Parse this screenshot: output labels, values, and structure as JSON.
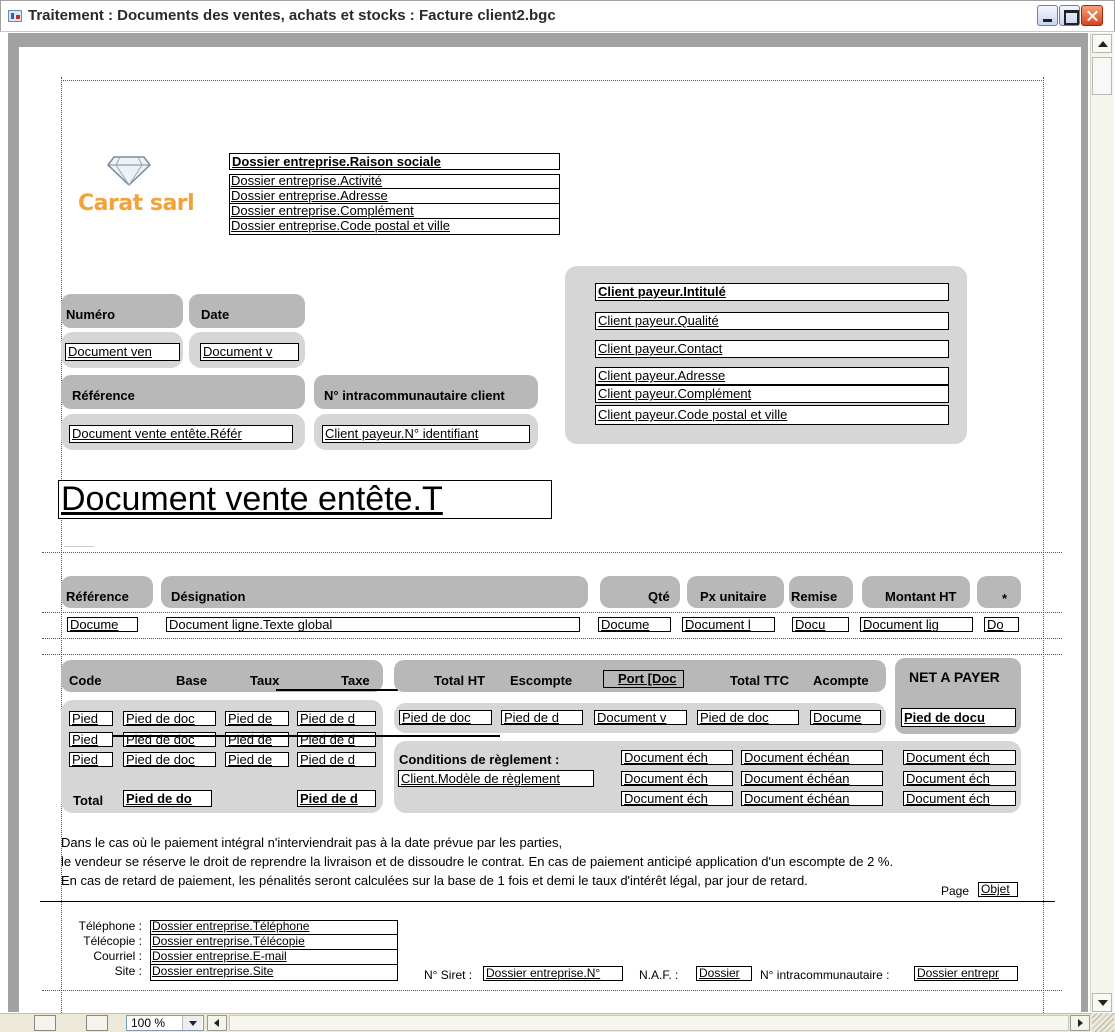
{
  "window": {
    "title": "Traitement : Documents des ventes, achats et stocks : Facture client2.bgc"
  },
  "statusbar": {
    "zoom": "100 %"
  },
  "header": {
    "logo_text": "Carat sarl",
    "company_fields": [
      "Dossier entreprise.Raison sociale",
      "Dossier entreprise.Activité",
      "Dossier entreprise.Adresse",
      "Dossier entreprise.Complément",
      "Dossier entreprise.Code postal et ville"
    ],
    "labels": {
      "numero": "Numéro",
      "date": "Date",
      "reference": "Référence",
      "intracom": "N° intracommunautaire client"
    },
    "values": {
      "numero": "Document ven",
      "date": "Document v",
      "reference": "Document vente entête.Référ",
      "intracom": "Client payeur.N° identifiant"
    },
    "client_fields": [
      "Client payeur.Intitulé",
      "Client payeur.Qualité",
      "Client payeur.Contact",
      "Client payeur.Adresse",
      "Client payeur.Complément",
      "Client payeur.Code postal et ville"
    ],
    "doc_title": "Document vente entête.T"
  },
  "lines": {
    "headers": [
      "Référence",
      "Désignation",
      "Qté",
      "Px unitaire",
      "Remise",
      "Montant HT",
      "*"
    ],
    "cells": [
      "Docume",
      "Document ligne.Texte global",
      "Docume",
      "Document l",
      "Docu",
      "Document lig",
      "Do"
    ]
  },
  "footer": {
    "tax_headers": [
      "Code",
      "Base",
      "Taux",
      "Taxe"
    ],
    "tax_rows": [
      [
        "Pied",
        "Pied de doc",
        "Pied de",
        "Pied de d"
      ],
      [
        "Pied",
        "Pied de doc",
        "Pied de",
        "Pied de d"
      ],
      [
        "Pied",
        "Pied de doc",
        "Pied de",
        "Pied de d"
      ]
    ],
    "total_label": "Total",
    "total_base": "Pied de do",
    "total_taxe": "Pied de d",
    "totals_headers": [
      "Total HT",
      "Escompte",
      "Port [Doc",
      "Total TTC",
      "Acompte"
    ],
    "totals_values": [
      "Pied de doc",
      "Pied de d",
      "Document v",
      "Pied de doc",
      "Docume"
    ],
    "net_label": "NET A PAYER",
    "net_value": "Pied de docu",
    "conditions_label": "Conditions de règlement :",
    "conditions_value": "Client.Modèle de règlement",
    "echeance_rows": [
      [
        "Document éch",
        "Document échéan",
        "Document éch"
      ],
      [
        "Document éch",
        "Document échéan",
        "Document éch"
      ],
      [
        "Document éch",
        "Document échéan",
        "Document éch"
      ]
    ],
    "legal_lines": [
      "Dans le cas où le paiement intégral n'interviendrait pas à la date prévue par les parties,",
      "le vendeur se réserve le droit de reprendre la livraison et de dissoudre le contrat. En cas de paiement anticipé application d'un escompte de 2 %.",
      "En cas de retard de paiement, les pénalités seront calculées sur la base de 1 fois et demi le taux d'intérêt légal, par jour de retard."
    ],
    "page_label": "Page",
    "page_value": "Objet"
  },
  "contact": {
    "labels": [
      "Téléphone :",
      "Télécopie :",
      "Courriel :",
      "Site :"
    ],
    "values": [
      "Dossier entreprise.Téléphone",
      "Dossier entreprise.Télécopie",
      "Dossier entreprise.E-mail",
      "Dossier entreprise.Site"
    ],
    "siret_label": "N° Siret :",
    "siret_value": "Dossier entreprise.N°",
    "naf_label": "N.A.F. :",
    "naf_value": "Dossier",
    "intracom_label": "N° intracommunautaire :",
    "intracom_value": "Dossier entrepr"
  }
}
